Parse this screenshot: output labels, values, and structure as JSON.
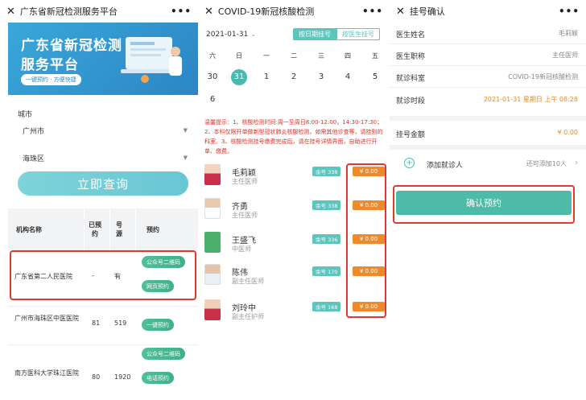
{
  "colors": {
    "accent": "#4cb9b1",
    "price": "#ef8a2a",
    "highlight": "#e03a2e",
    "button_green": "#3db08a"
  },
  "panel1": {
    "title": "广东省新冠检测服务平台",
    "menu": "•••",
    "banner": {
      "line1": "广东省新冠检测",
      "line2": "服务平台",
      "tag": "一键预约 · 方便快捷"
    },
    "city_label": "城市",
    "city_value": "广州市",
    "district_value": "海珠区",
    "query_button": "立即查询",
    "table_headers": {
      "name": "机构名称",
      "booked": "已预约",
      "source": "号源",
      "book": "预约"
    },
    "rows": [
      {
        "name": "广东省第二人民医院",
        "booked": "-",
        "source": "有",
        "btn1": "公众号二维码",
        "btn2": "网页预约"
      },
      {
        "name": "广州市海珠区中医医院",
        "booked": "81",
        "source": "519",
        "btn1": "一键预约"
      },
      {
        "name": "南方医科大学珠江医院",
        "booked": "80",
        "source": "1920",
        "btn1": "公众号二维码",
        "btn2": "电话预约"
      }
    ]
  },
  "panel2": {
    "title": "COVID-19新冠核酸检测",
    "menu": "•••",
    "date": "2021-01-31",
    "seg_by_date": "按日期挂号",
    "seg_by_doctor": "按医生挂号",
    "weekdays": [
      "六",
      "日",
      "一",
      "二",
      "三",
      "四",
      "五"
    ],
    "days": [
      "30",
      "31",
      "1",
      "2",
      "3",
      "4",
      "5",
      "6"
    ],
    "tip": "温馨提示：1、核酸检测时间:周一至周日8:00-12:00，14:30-17:30；2、本科仅限开单做新型冠状肺炎核酸检测。如需其他诊查等，请挂别的科室。3、核酸检测挂号缴费完成后，请在挂号详情界面，自助进行开单、缴费。",
    "doctors": [
      {
        "name": "毛莉颖",
        "title": "主任医师",
        "remain": "余号 338",
        "price": "¥ 0.00"
      },
      {
        "name": "齐勇",
        "title": "主任医师",
        "remain": "余号 338",
        "price": "¥ 0.00"
      },
      {
        "name": "王盛飞",
        "title": "中医师",
        "remain": "余号 336",
        "price": "¥ 0.00"
      },
      {
        "name": "陈伟",
        "title": "副主任医师",
        "remain": "余号 170",
        "price": "¥ 0.00"
      },
      {
        "name": "刘玲中",
        "title": "副主任护师",
        "remain": "余号 168",
        "price": "¥ 0.00"
      }
    ]
  },
  "panel3": {
    "title": "挂号确认",
    "menu": "•••",
    "fields": [
      {
        "k": "医生姓名",
        "v": "毛莉颖"
      },
      {
        "k": "医生职称",
        "v": "主任医师"
      },
      {
        "k": "就诊科室",
        "v": "COVID-19新冠核酸检测"
      },
      {
        "k": "就诊时段",
        "v": "2021-01-31 星期日 上午 08:28"
      }
    ],
    "fee_label": "挂号金额",
    "fee_value": "¥ 0.00",
    "add_label": "添加就诊人",
    "add_hint": "还可添加10人",
    "confirm_button": "确认预约"
  }
}
